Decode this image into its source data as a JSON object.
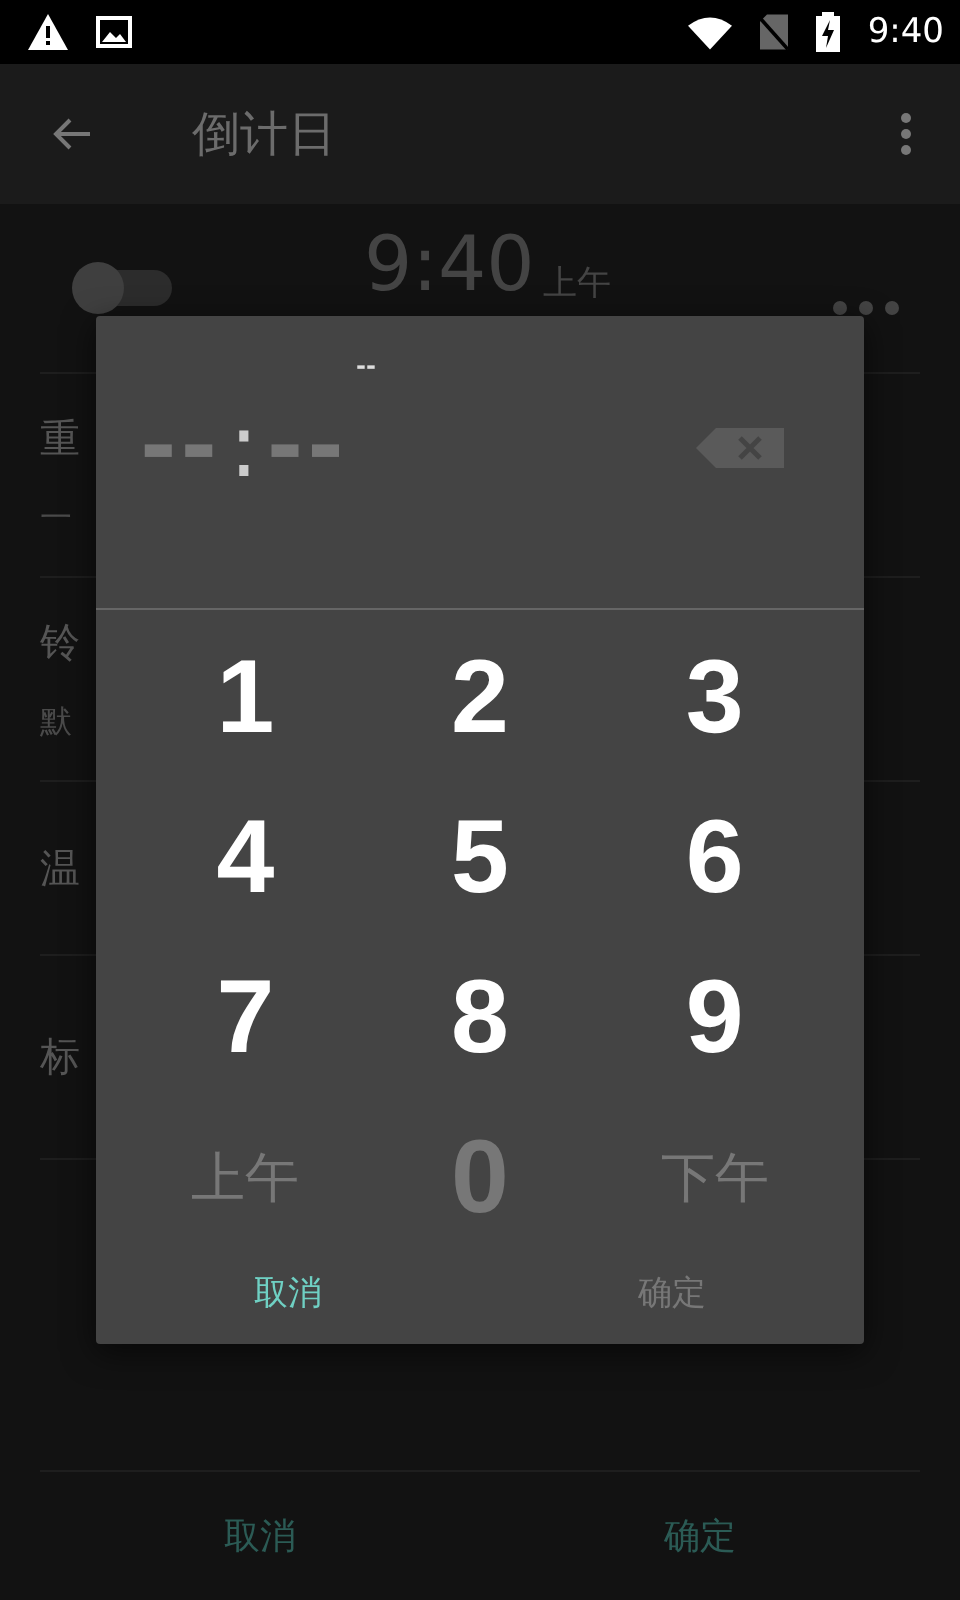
{
  "status_bar": {
    "time": "9:40"
  },
  "app_bar": {
    "title": "倒计日"
  },
  "alarm": {
    "time": "9:40",
    "period": "上午",
    "on": false
  },
  "settings": [
    {
      "title": "重",
      "subtitle": "一"
    },
    {
      "title": "铃",
      "subtitle": "默"
    },
    {
      "title": "温"
    },
    {
      "title": "标"
    }
  ],
  "footer_buttons": [
    {
      "label": "取消"
    },
    {
      "label": "确定"
    }
  ],
  "dialog": {
    "hint": "--",
    "hours": "--",
    "separator": ":",
    "minutes": "--",
    "keys": [
      {
        "label": "1",
        "disabled": false
      },
      {
        "label": "2",
        "disabled": false
      },
      {
        "label": "3",
        "disabled": false
      },
      {
        "label": "4",
        "disabled": false
      },
      {
        "label": "5",
        "disabled": false
      },
      {
        "label": "6",
        "disabled": false
      },
      {
        "label": "7",
        "disabled": false
      },
      {
        "label": "8",
        "disabled": false
      },
      {
        "label": "9",
        "disabled": false
      },
      {
        "label": "上午",
        "disabled": true
      },
      {
        "label": "0",
        "disabled": true
      },
      {
        "label": "下午",
        "disabled": true
      }
    ],
    "buttons": [
      {
        "label": "取消",
        "disabled": false
      },
      {
        "label": "确定",
        "disabled": true
      }
    ]
  }
}
